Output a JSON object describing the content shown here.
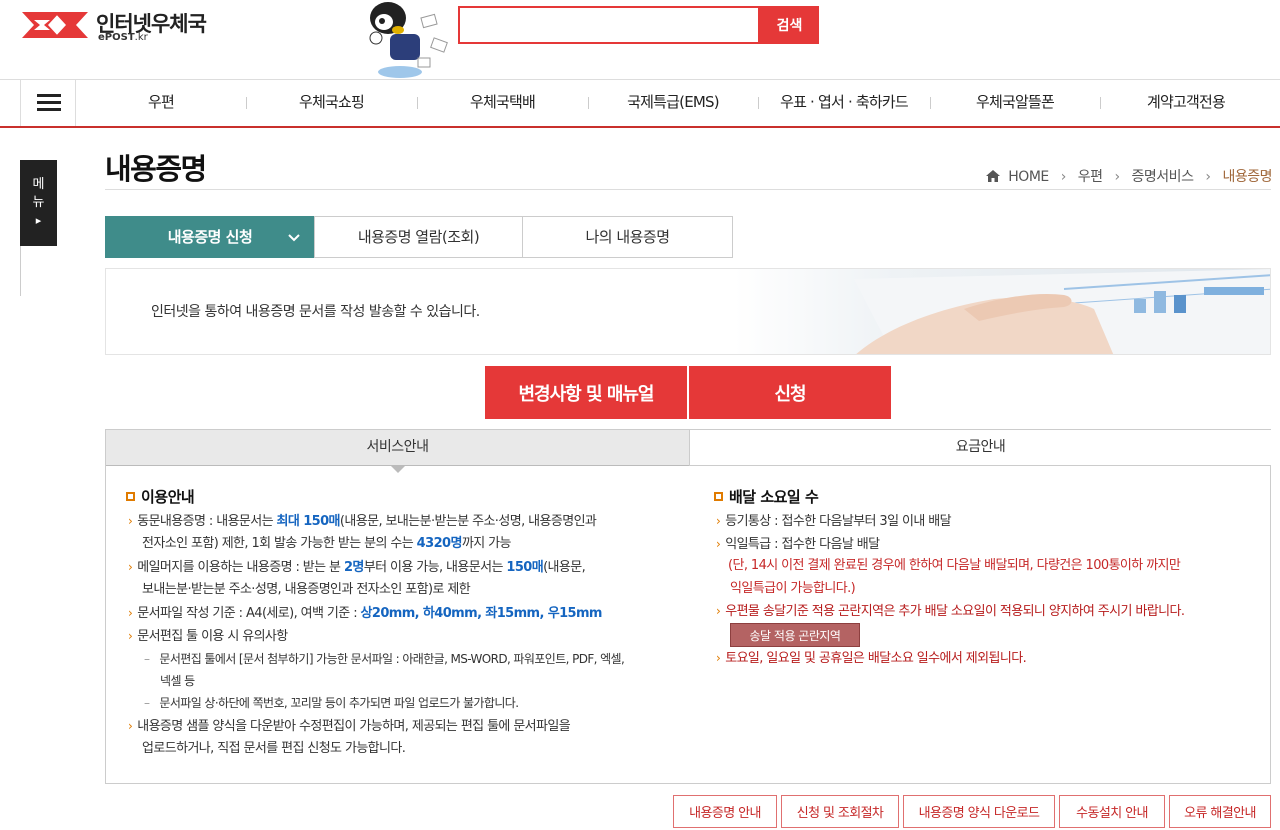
{
  "header": {
    "logo_title": "인터넷우체국",
    "logo_sub_bold": "ePOST",
    "logo_sub_rest": ".kr",
    "search_placeholder": "",
    "search_button": "검색"
  },
  "gnb": {
    "items": [
      "우편",
      "우체국쇼핑",
      "우체국택배",
      "국제특급(EMS)",
      "우표 · 엽서 · 축하카드",
      "우체국알뜰폰",
      "계약고객전용"
    ]
  },
  "side_menu": {
    "label_1": "메",
    "label_2": "뉴",
    "arrow": "▸"
  },
  "page": {
    "title": "내용증명",
    "breadcrumb": [
      "HOME",
      "우편",
      "증명서비스",
      "내용증명"
    ]
  },
  "tabs": [
    {
      "label": "내용증명 신청",
      "active": true
    },
    {
      "label": "내용증명 열람(조회)",
      "active": false
    },
    {
      "label": "나의 내용증명",
      "active": false
    }
  ],
  "banner": {
    "text": "인터넷을 통하여 내용증명 문서를 작성 발송할 수 있습니다."
  },
  "actions": {
    "manual": "변경사항 및 매뉴얼",
    "apply": "신청"
  },
  "info_tabs": {
    "service": "서비스안내",
    "fee": "요금안내"
  },
  "usage": {
    "title": "이용안내",
    "l1a": "동문내용증명 : 내용문서는 ",
    "l1b": "최대 150매",
    "l1c": "(내용문, 보내는분·받는분 주소·성명, 내용증명인과",
    "l2a": "전자소인 포함) 제한, 1회 발송 가능한 받는 분의 수는 ",
    "l2b": "4320명",
    "l2c": "까지 가능",
    "l3a": "메일머지를 이용하는 내용증명 : 받는 분 ",
    "l3b": "2명",
    "l3c": "부터 이용 가능, 내용문서는 ",
    "l3d": "150매",
    "l3e": "(내용문,",
    "l4": "보내는분·받는분 주소·성명, 내용증명인과 전자소인 포함)로 제한",
    "l5a": "문서파일 작성 기준 : A4(세로), 여백 기준 : ",
    "l5b": "상20mm, 하40mm, 좌15mm, 우15mm",
    "l6": "문서편집 툴 이용 시 유의사항",
    "l7": "문서편집 툴에서 [문서 첨부하기] 가능한 문서파일 : 아래한글, MS-WORD, 파워포인트, PDF, 엑셀,",
    "l8": "넥셀 등",
    "l9": "문서파일 상·하단에 쪽번호, 꼬리말 등이 추가되면 파일 업로드가 불가합니다.",
    "l10": "내용증명 샘플 양식을 다운받아 수정편집이 가능하며, 제공되는 편집 툴에 문서파일을",
    "l11": "업로드하거나, 직접 문서를 편집 신청도 가능합니다."
  },
  "delivery": {
    "title": "배달 소요일 수",
    "l1": "등기통상 : 접수한 다음날부터 3일 이내 배달",
    "l2": "익일특급 : 접수한 다음날 배달",
    "l3": "(단, 14시 이전 결제 완료된 경우에 한하여 다음날 배달되며, 다량건은 100통이하 까지만",
    "l4": "익일특급이 가능합니다.)",
    "l5": "우편물 송달기준 적용 곤란지역은 추가 배달 소요일이 적용되니 양지하여 주시기 바랍니다.",
    "area_button": "송달 적용 곤란지역",
    "l6": "토요일, 일요일 및 공휴일은 배달소요 일수에서 제외됩니다."
  },
  "bottom_links": [
    "내용증명 안내",
    "신청 및 조회절차",
    "내용증명 양식 다운로드",
    "수동설치 안내",
    "오류 해결안내"
  ],
  "colors": {
    "brand_red": "#e53838",
    "tab_teal": "#3f8c8a",
    "accent_orange": "#e07b00",
    "link_blue": "#1565c0"
  }
}
